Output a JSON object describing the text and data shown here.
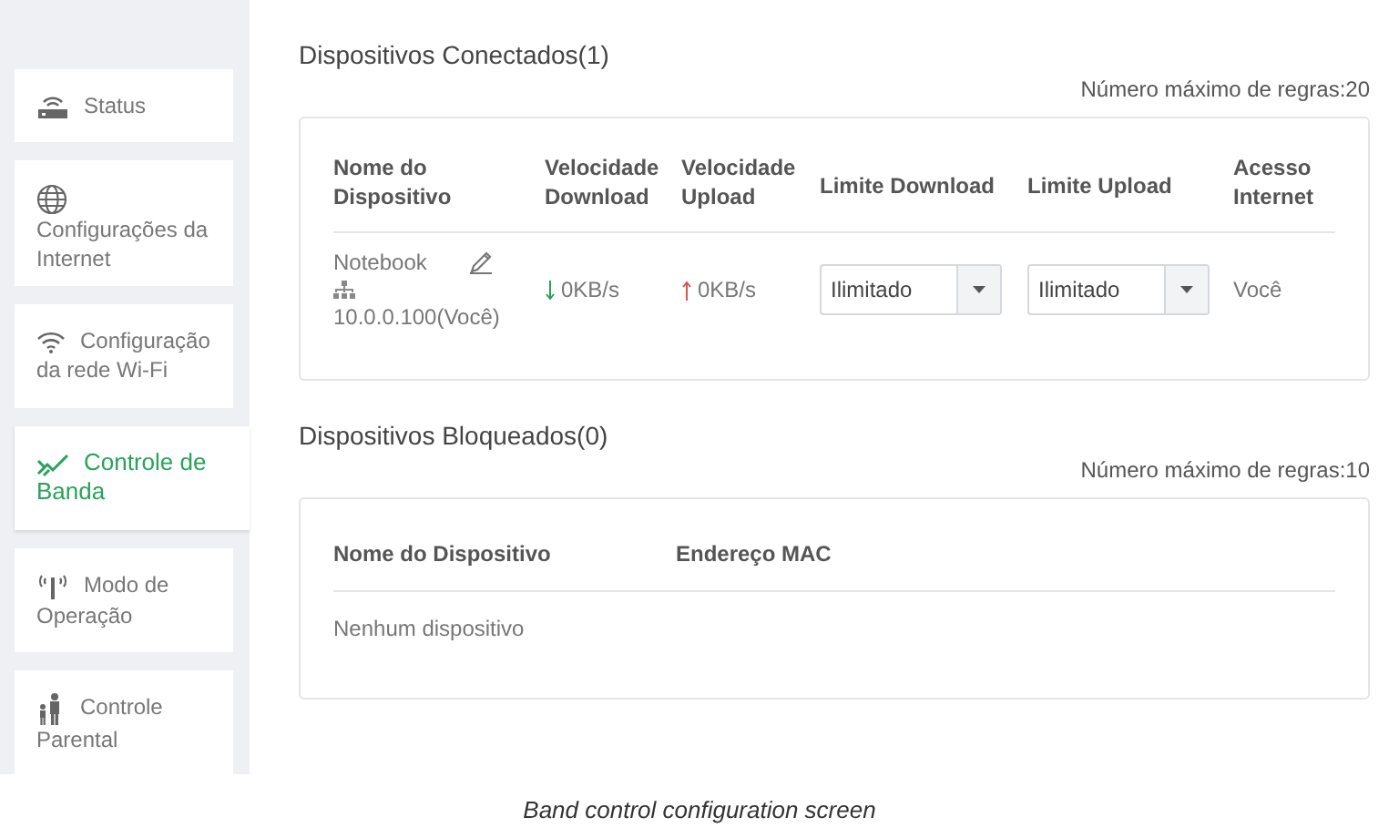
{
  "sidebar": {
    "items": [
      {
        "label": "Status",
        "selected": false
      },
      {
        "label": "Configurações da Internet",
        "selected": false
      },
      {
        "label": "Configuração da rede Wi-Fi",
        "selected": false
      },
      {
        "label": "Controle de Banda",
        "selected": true
      },
      {
        "label": "Modo de Operação",
        "selected": false
      },
      {
        "label": "Controle Parental",
        "selected": false
      }
    ]
  },
  "connected": {
    "title": "Dispositivos Conectados(1)",
    "max_rules": "Número máximo de regras:20",
    "columns": [
      "Nome do Dispositivo",
      "Velocidade Download",
      "Velocidade Upload",
      "Limite Download",
      "Limite Upload",
      "Acesso Internet"
    ],
    "rows": [
      {
        "name": "Notebook",
        "ip": "10.0.0.100(Você)",
        "download": "0KB/s",
        "upload": "0KB/s",
        "limit_download": "Ilimitado",
        "limit_upload": "Ilimitado",
        "access": "Você"
      }
    ]
  },
  "blocked": {
    "title": "Dispositivos Bloqueados(0)",
    "max_rules": "Número máximo de regras:10",
    "columns": [
      "Nome do Dispositivo",
      "Endereço MAC"
    ],
    "empty": "Nenhum dispositivo"
  },
  "caption": "Band control configuration screen"
}
